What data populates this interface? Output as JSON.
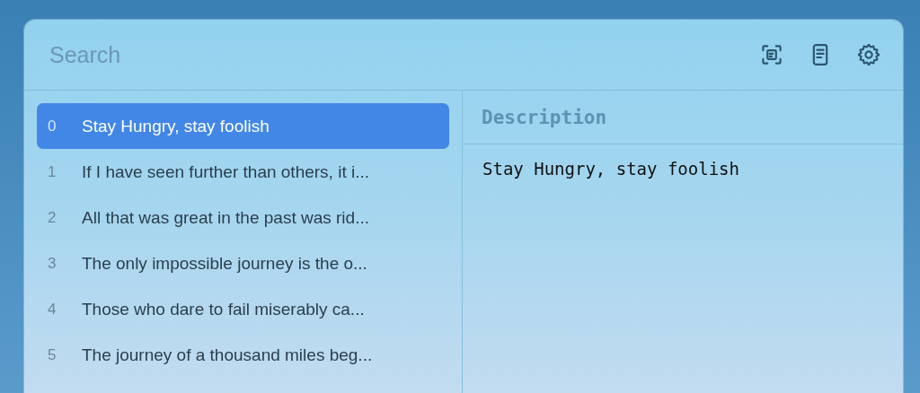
{
  "search": {
    "placeholder": "Search"
  },
  "toolbar": [
    {
      "kind": "scan"
    },
    {
      "kind": "document"
    },
    {
      "kind": "settings"
    }
  ],
  "items": [
    {
      "index": "0",
      "text": "Stay Hungry, stay foolish",
      "selected": true
    },
    {
      "index": "1",
      "text": "If I have seen further than others, it i...",
      "selected": false
    },
    {
      "index": "2",
      "text": "All that was great in the past was rid...",
      "selected": false
    },
    {
      "index": "3",
      "text": "The only impossible journey is the o...",
      "selected": false
    },
    {
      "index": "4",
      "text": "Those who dare to fail miserably ca...",
      "selected": false
    },
    {
      "index": "5",
      "text": "The journey of a thousand miles beg...",
      "selected": false
    }
  ],
  "detail": {
    "heading": "Description",
    "body": "Stay Hungry, stay foolish"
  }
}
